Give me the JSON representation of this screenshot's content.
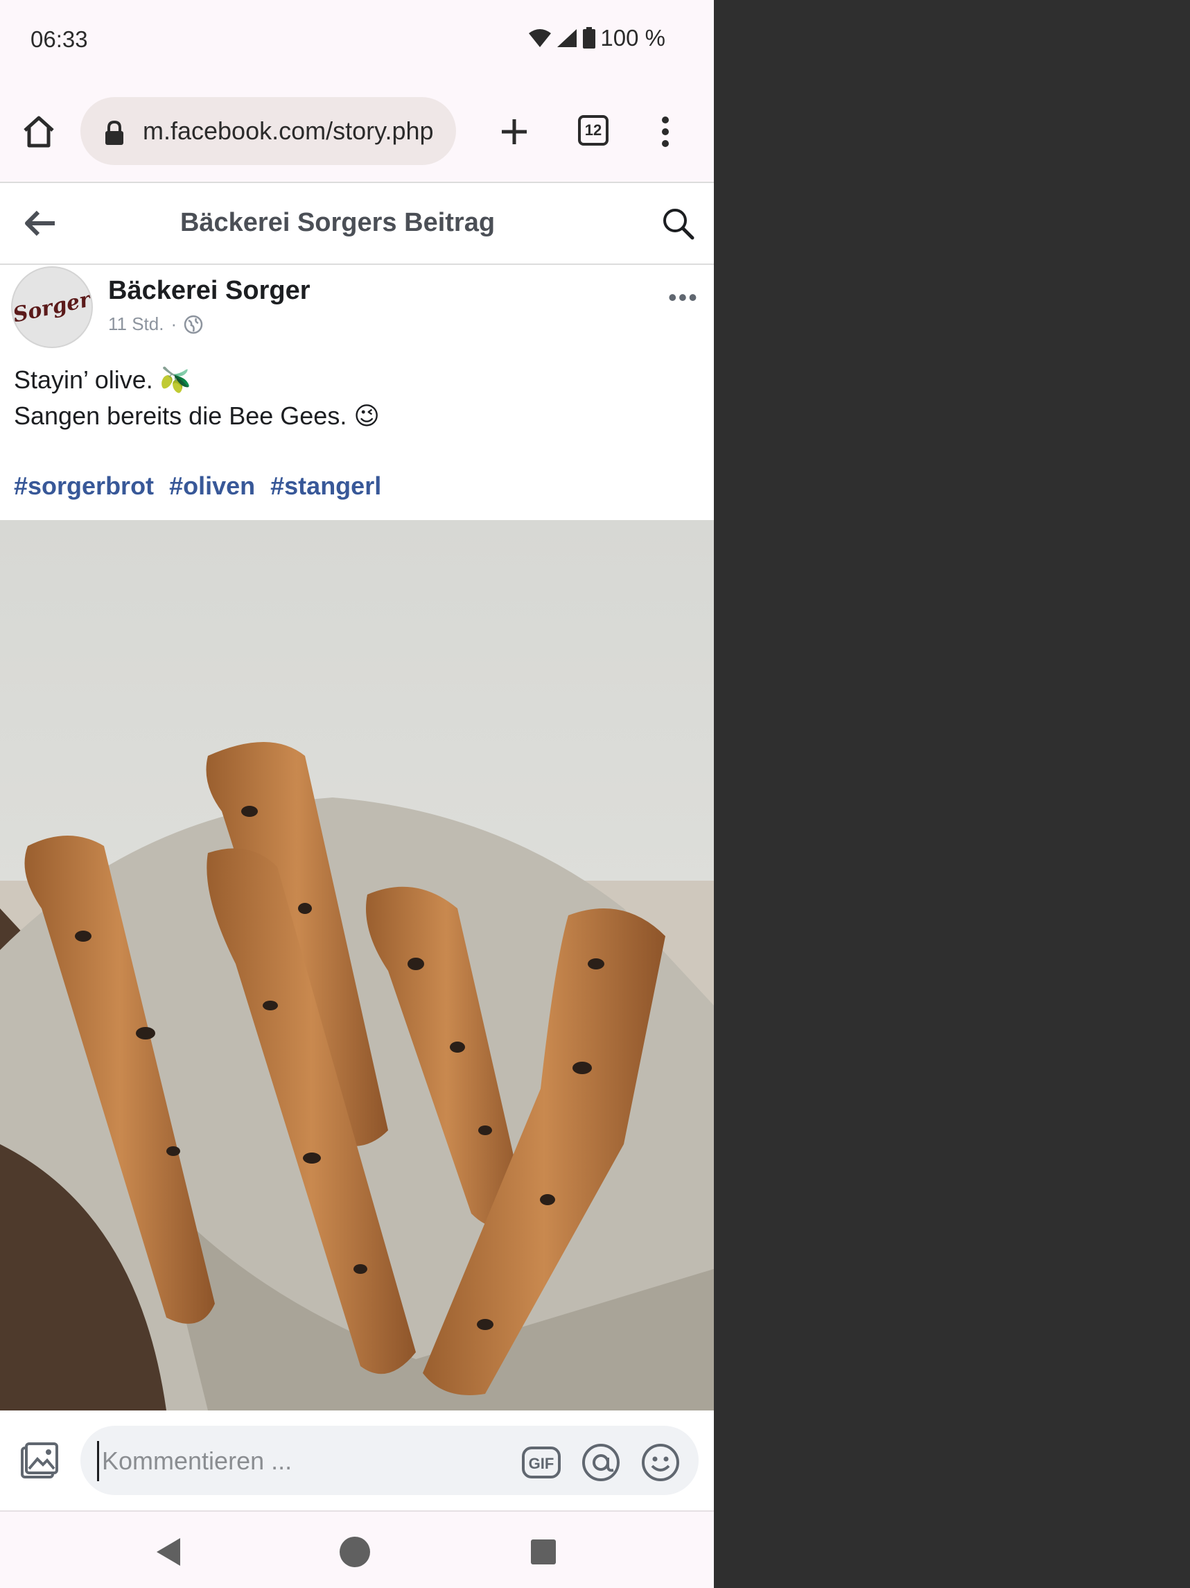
{
  "status_bar": {
    "time": "06:33",
    "battery": "100 %"
  },
  "browser": {
    "url": "m.facebook.com/story.php",
    "tab_count": "12"
  },
  "header": {
    "title": "Bäckerei Sorgers Beitrag"
  },
  "post": {
    "avatar_text": "Sorger",
    "page_name": "Bäckerei Sorger",
    "time": "11 Std.",
    "caption_line1": "Stayin’ olive. 🫒",
    "caption_line2": "Sangen bereits die Bee Gees. 😉",
    "hashtags": [
      "#sorgerbrot",
      "#oliven",
      "#stangerl"
    ]
  },
  "comment": {
    "placeholder": "Kommentieren ..."
  },
  "icons": {
    "home": "home-icon",
    "lock": "lock-icon",
    "new_tab": "plus-icon",
    "tabs": "tab-switcher-icon",
    "menu": "more-vert-icon",
    "back": "arrow-left-icon",
    "search": "search-icon",
    "more": "more-horiz-icon",
    "globe": "globe-icon",
    "photo": "photo-icon",
    "gif": "gif-icon",
    "mention": "at-icon",
    "emoji": "emoji-icon"
  },
  "colors": {
    "link": "#385898",
    "background_right": "#2f2f2f",
    "chrome_bar": "#fdf7fb"
  }
}
